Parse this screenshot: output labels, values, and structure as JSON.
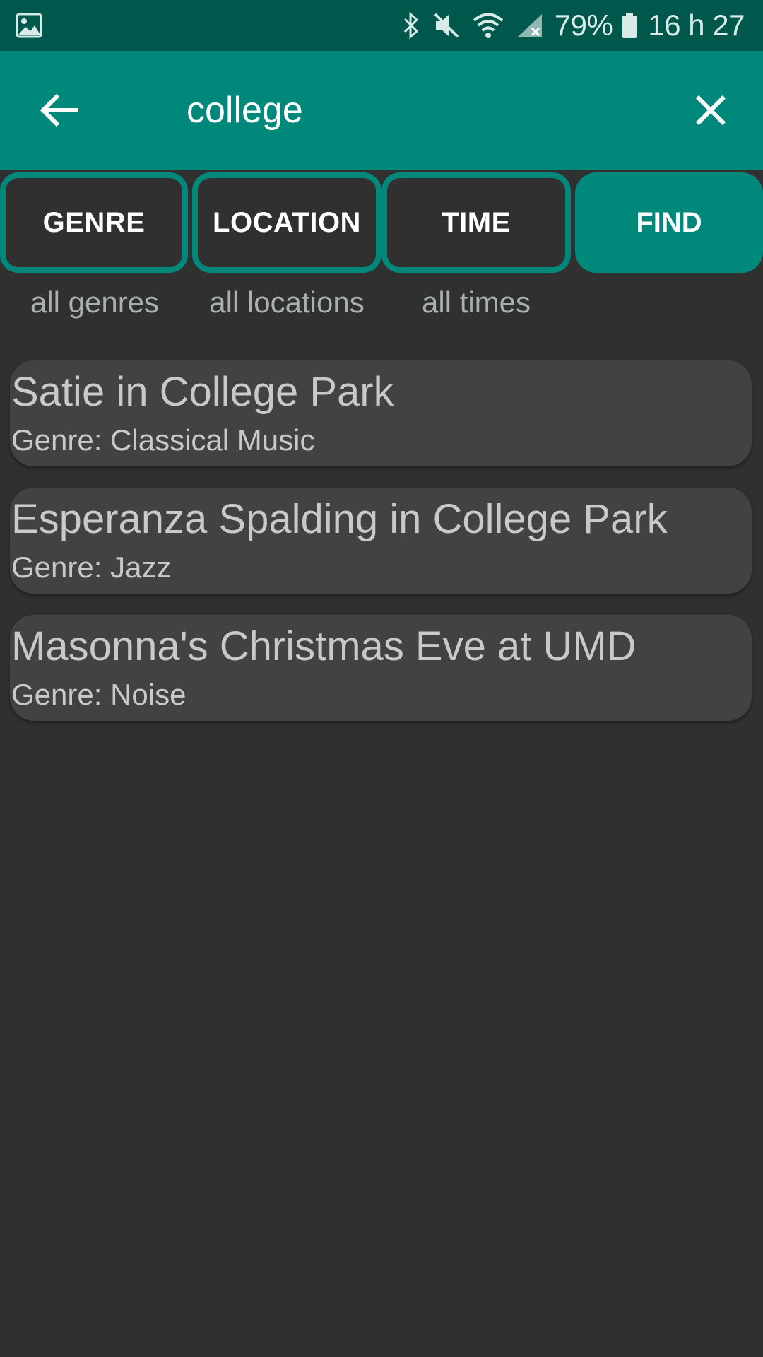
{
  "status_bar": {
    "battery_percent": "79%",
    "time": "16 h 27",
    "icons": [
      "image-icon",
      "bluetooth-icon",
      "mute-icon",
      "wifi-icon",
      "signal-icon",
      "battery-icon"
    ]
  },
  "toolbar": {
    "search_value": "college"
  },
  "filters": {
    "genre": {
      "label": "GENRE",
      "value": "all genres"
    },
    "location": {
      "label": "LOCATION",
      "value": "all locations"
    },
    "time": {
      "label": "TIME",
      "value": "all times"
    },
    "find_label": "FIND"
  },
  "results": [
    {
      "title": "Satie in College Park",
      "genre": "Genre: Classical Music"
    },
    {
      "title": "Esperanza Spalding in College Park",
      "genre": "Genre: Jazz"
    },
    {
      "title": "Masonna's Christmas Eve at UMD",
      "genre": "Genre: Noise"
    }
  ],
  "colors": {
    "status_bar": "#00574b",
    "accent": "#00897b",
    "background": "#303030",
    "card": "#424242"
  }
}
